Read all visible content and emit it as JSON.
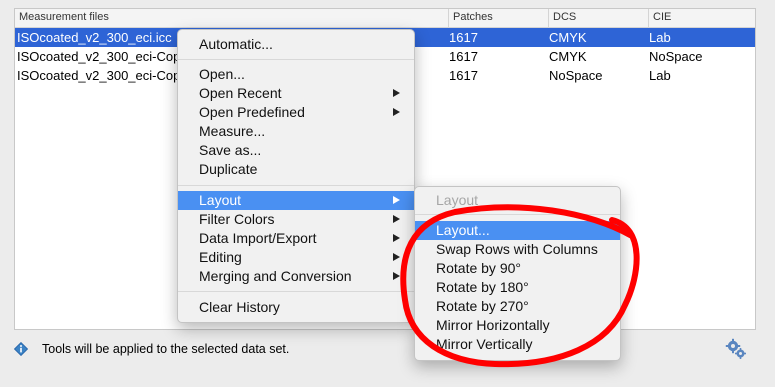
{
  "table": {
    "headers": [
      "Measurement files",
      "Patches",
      "DCS",
      "CIE"
    ],
    "rows": [
      [
        "ISOcoated_v2_300_eci.icc",
        "1617",
        "CMYK",
        "Lab"
      ],
      [
        "ISOcoated_v2_300_eci-Cop",
        "1617",
        "CMYK",
        "NoSpace"
      ],
      [
        "ISOcoated_v2_300_eci-Cop",
        "1617",
        "NoSpace",
        "Lab"
      ]
    ],
    "selected_row": 0
  },
  "status": {
    "text": "Tools will be applied to the selected data set.",
    "info_icon": "info-icon",
    "gear_icon": "gear-icon"
  },
  "context_menu": {
    "automatic": "Automatic...",
    "open": "Open...",
    "open_recent": "Open Recent",
    "open_predefined": "Open Predefined",
    "measure": "Measure...",
    "save_as": "Save as...",
    "duplicate": "Duplicate",
    "layout": "Layout",
    "filter_colors": "Filter Colors",
    "data_import_export": "Data Import/Export",
    "editing": "Editing",
    "merging_conversion": "Merging and Conversion",
    "clear_history": "Clear History"
  },
  "submenu": {
    "header": "Layout",
    "items": [
      "Layout...",
      "Swap Rows with Columns",
      "Rotate by 90°",
      "Rotate by 180°",
      "Rotate by 270°",
      "Mirror Horizontally",
      "Mirror Vertically"
    ]
  },
  "colors": {
    "selection": "#2e64d6",
    "menu_highlight": "#4a90f2",
    "annotation": "#ff0000"
  }
}
